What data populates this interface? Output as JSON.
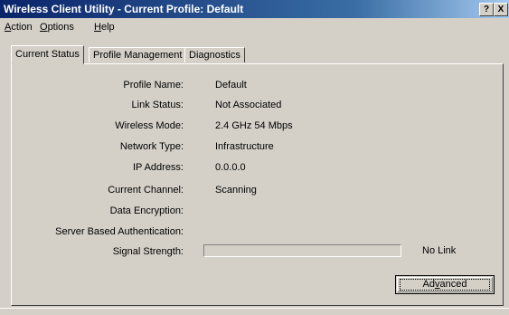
{
  "window": {
    "title": "Wireless Client Utility - Current Profile: Default",
    "help_button": "?",
    "close_button": "X"
  },
  "menu": [
    {
      "pre": "",
      "key": "A",
      "post": "ction"
    },
    {
      "pre": "",
      "key": "O",
      "post": "ptions"
    },
    {
      "pre": "",
      "key": "H",
      "post": "elp"
    }
  ],
  "tabs": [
    "Current Status",
    "Profile Management",
    "Diagnostics"
  ],
  "status": {
    "profile_name_label": "Profile Name:",
    "profile_name": "Default",
    "link_status_label": "Link Status:",
    "link_status": "Not Associated",
    "wireless_mode_label": "Wireless Mode:",
    "wireless_mode": "2.4 GHz 54 Mbps",
    "network_type_label": "Network Type:",
    "network_type": "Infrastructure",
    "ip_address_label": "IP Address:",
    "ip_address": "0.0.0.0",
    "current_channel_label": "Current Channel:",
    "current_channel": "Scanning",
    "data_encryption_label": "Data Encryption:",
    "data_encryption": "",
    "server_auth_label": "Server Based Authentication:",
    "server_auth": "",
    "signal_strength_label": "Signal Strength:",
    "signal_strength_text": "No Link",
    "signal_level": 0
  },
  "advanced_button": {
    "pre": "Ad",
    "key": "v",
    "post": "anced"
  }
}
